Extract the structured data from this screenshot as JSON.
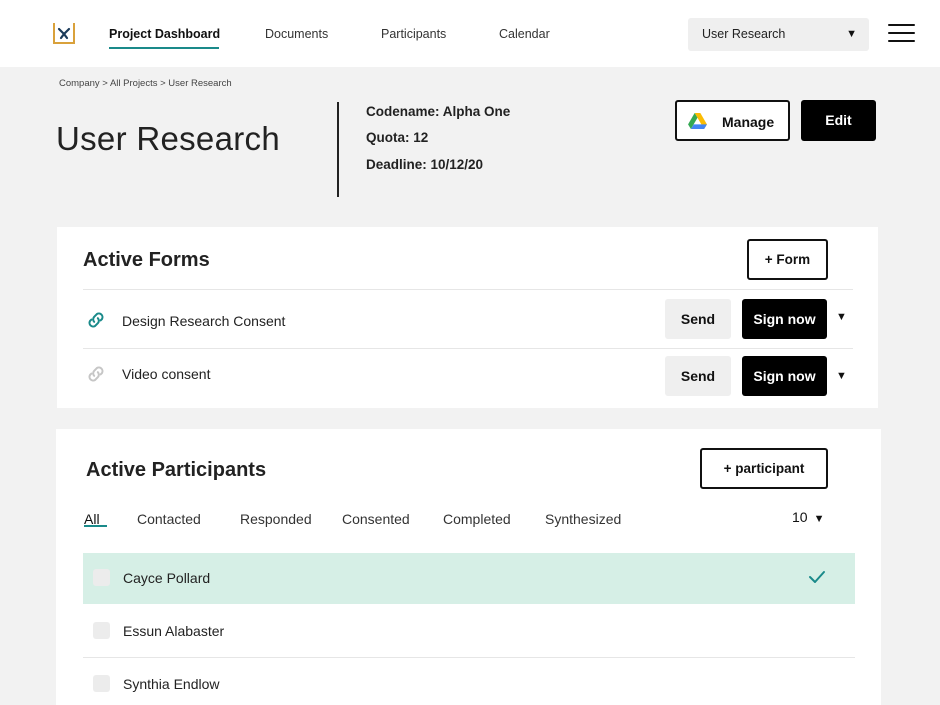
{
  "nav": {
    "items": [
      "Project Dashboard",
      "Documents",
      "Participants",
      "Calendar"
    ],
    "project_select": "User Research"
  },
  "breadcrumb": "Company > All Projects > User Research",
  "page": {
    "title": "User Research",
    "codename": "Codename: Alpha One",
    "quota": "Quota: 12",
    "deadline": "Deadline: 10/12/20",
    "manage_label": "Manage",
    "edit_label": "Edit"
  },
  "forms": {
    "title": "Active Forms",
    "add_label": "+ Form",
    "send_label": "Send",
    "sign_label": "Sign now",
    "rows": [
      {
        "name": "Design Research Consent",
        "link_color": "#1a8a8a"
      },
      {
        "name": "Video consent",
        "link_color": "#c6c6c6"
      }
    ]
  },
  "participants": {
    "title": "Active Participants",
    "add_label": "+ participant",
    "tabs": [
      "All",
      "Contacted",
      "Responded",
      "Consented",
      "Completed",
      "Synthesized"
    ],
    "per_page": "10",
    "rows": [
      {
        "name": "Cayce Pollard",
        "selected": true
      },
      {
        "name": "Essun Alabaster",
        "selected": false
      },
      {
        "name": "Synthia Endlow",
        "selected": false
      }
    ]
  },
  "colors": {
    "accent": "#1a8a8a",
    "selected_row": "#d6efe6"
  }
}
